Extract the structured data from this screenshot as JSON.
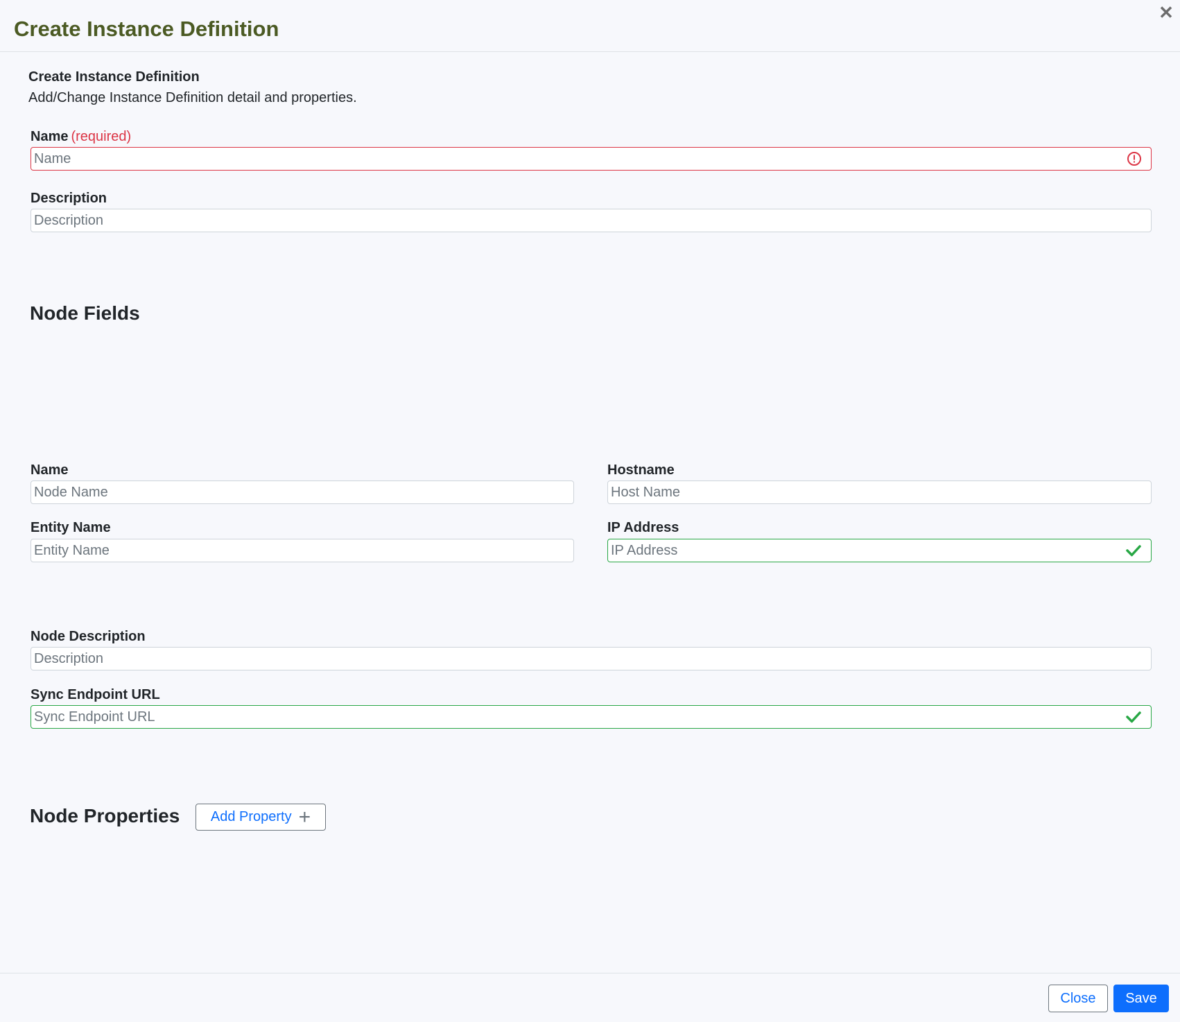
{
  "dialog": {
    "title": "Create Instance Definition",
    "close_icon": "close-icon"
  },
  "intro": {
    "title": "Create Instance Definition",
    "description": "Add/Change Instance Definition detail and properties."
  },
  "definition_fields": {
    "name": {
      "label": "Name",
      "required_text": "(required)",
      "value": "",
      "placeholder": "Name",
      "status": "invalid",
      "status_icon": "error-circle-icon"
    },
    "description": {
      "label": "Description",
      "value": "",
      "placeholder": "Description"
    }
  },
  "node_fields": {
    "heading": "Node Fields",
    "name": {
      "label": "Name",
      "value": "",
      "placeholder": "Node Name"
    },
    "hostname": {
      "label": "Hostname",
      "value": "",
      "placeholder": "Host Name"
    },
    "entity_name": {
      "label": "Entity Name",
      "value": "",
      "placeholder": "Entity Name"
    },
    "ip_address": {
      "label": "IP Address",
      "value": "",
      "placeholder": "IP Address",
      "status": "valid",
      "status_icon": "check-icon"
    },
    "node_description": {
      "label": "Node Description",
      "value": "",
      "placeholder": "Description"
    },
    "sync_endpoint_url": {
      "label": "Sync Endpoint URL",
      "value": "",
      "placeholder": "Sync Endpoint URL",
      "status": "valid",
      "status_icon": "check-icon"
    }
  },
  "node_properties": {
    "heading": "Node Properties",
    "add_button_label": "Add Property",
    "add_icon": "plus-icon"
  },
  "footer": {
    "close_label": "Close",
    "save_label": "Save"
  },
  "colors": {
    "title": "#4b5a23",
    "error": "#dc3545",
    "success": "#28a745",
    "primary": "#0d6efd"
  }
}
